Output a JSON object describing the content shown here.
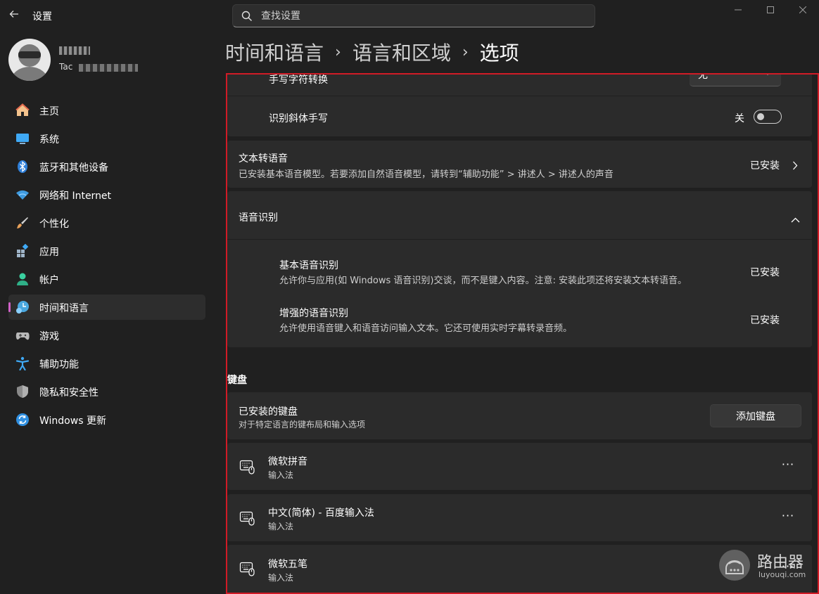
{
  "window": {
    "title": "设置",
    "controls": [
      "minimize",
      "maximize",
      "close"
    ]
  },
  "search": {
    "placeholder": "查找设置"
  },
  "profile": {
    "email_prefix": "Tac"
  },
  "sidebar": {
    "items": [
      {
        "label": "主页",
        "icon": "home-icon"
      },
      {
        "label": "系统",
        "icon": "system-icon"
      },
      {
        "label": "蓝牙和其他设备",
        "icon": "bluetooth-icon"
      },
      {
        "label": "网络和 Internet",
        "icon": "wifi-icon"
      },
      {
        "label": "个性化",
        "icon": "brush-icon"
      },
      {
        "label": "应用",
        "icon": "apps-icon"
      },
      {
        "label": "帐户",
        "icon": "account-icon"
      },
      {
        "label": "时间和语言",
        "icon": "time-language-icon",
        "active": true
      },
      {
        "label": "游戏",
        "icon": "gamepad-icon"
      },
      {
        "label": "辅助功能",
        "icon": "accessibility-icon"
      },
      {
        "label": "隐私和安全性",
        "icon": "shield-icon"
      },
      {
        "label": "Windows 更新",
        "icon": "update-icon"
      }
    ],
    "active_indicator_color": "#d162c8"
  },
  "breadcrumb": {
    "items": [
      "时间和语言",
      "语言和区域",
      "选项"
    ],
    "separator": "›"
  },
  "handwriting": {
    "convert_label": "手写字符转换",
    "convert_value": "无",
    "italic_label": "识别斜体手写",
    "italic_state": "关"
  },
  "tts": {
    "title": "文本转语音",
    "description": "已安装基本语音模型。若要添加自然语音模型，请转到“辅助功能” > 讲述人 > 讲述人的声音",
    "status": "已安装"
  },
  "speech": {
    "title": "语音识别",
    "basic_title": "基本语音识别",
    "basic_description": "允许你与应用(如 Windows 语音识别)交谈，而不是键入内容。注意: 安装此项还将安装文本转语音。",
    "basic_status": "已安装",
    "enhanced_title": "增强的语音识别",
    "enhanced_description": "允许使用语音键入和语音访问输入文本。它还可使用实时字幕转录音频。",
    "enhanced_status": "已安装"
  },
  "keyboard": {
    "heading": "键盘",
    "installed_title": "已安装的键盘",
    "installed_description": "对于特定语言的键布局和输入选项",
    "add_button": "添加键盘",
    "keyboards": [
      {
        "name": "微软拼音",
        "type": "输入法"
      },
      {
        "name": "中文(简体) - 百度输入法",
        "type": "输入法"
      },
      {
        "name": "微软五笔",
        "type": "输入法"
      }
    ],
    "more_label": "···"
  },
  "watermark": {
    "title": "路由器",
    "subtitle": "luyouqi.com"
  },
  "colors": {
    "background": "#202020",
    "card": "#2b2b2b",
    "highlight_frame": "#d11b26"
  }
}
